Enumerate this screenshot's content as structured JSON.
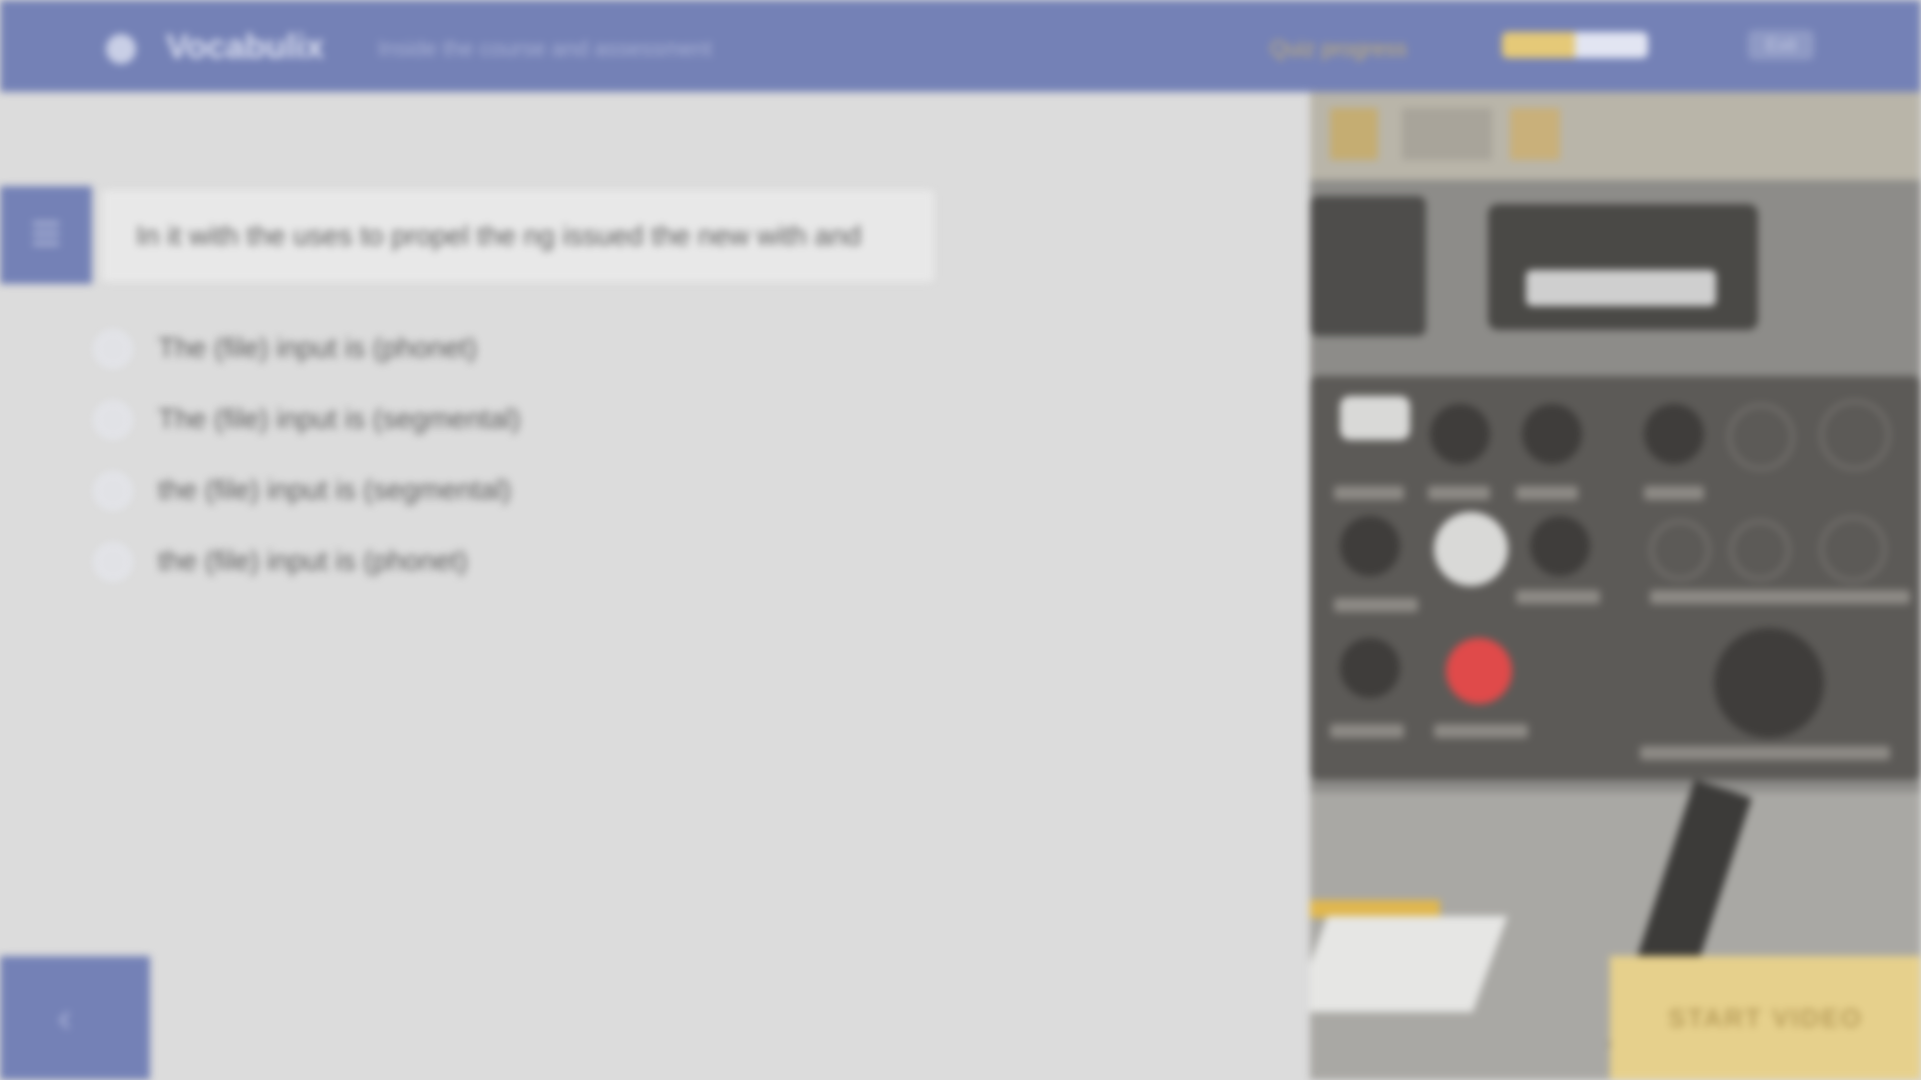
{
  "header": {
    "logo_text": "Vocabulix",
    "quiz_title": "Inside the course and assessment",
    "progress_label": "Quiz progress",
    "progress_fraction": 0.5,
    "exit_label": "Exit"
  },
  "question": {
    "text": "In it with the uses to propel the ng issued the new with and",
    "options": [
      {
        "label": "The (file) input is (phonet)"
      },
      {
        "label": "The (file) input is (segmental)"
      },
      {
        "label": "the (file) input is (segmental)"
      },
      {
        "label": "the (file) input is (phonet)"
      }
    ]
  },
  "buttons": {
    "start_label": "START VIDEO"
  },
  "icons": {
    "menu": "menu-icon",
    "back": "chevron-left-icon",
    "logo": "logo-icon"
  },
  "colors": {
    "brand": "#7481b6",
    "accent": "#e6d08c",
    "background": "#dcdcdc"
  }
}
